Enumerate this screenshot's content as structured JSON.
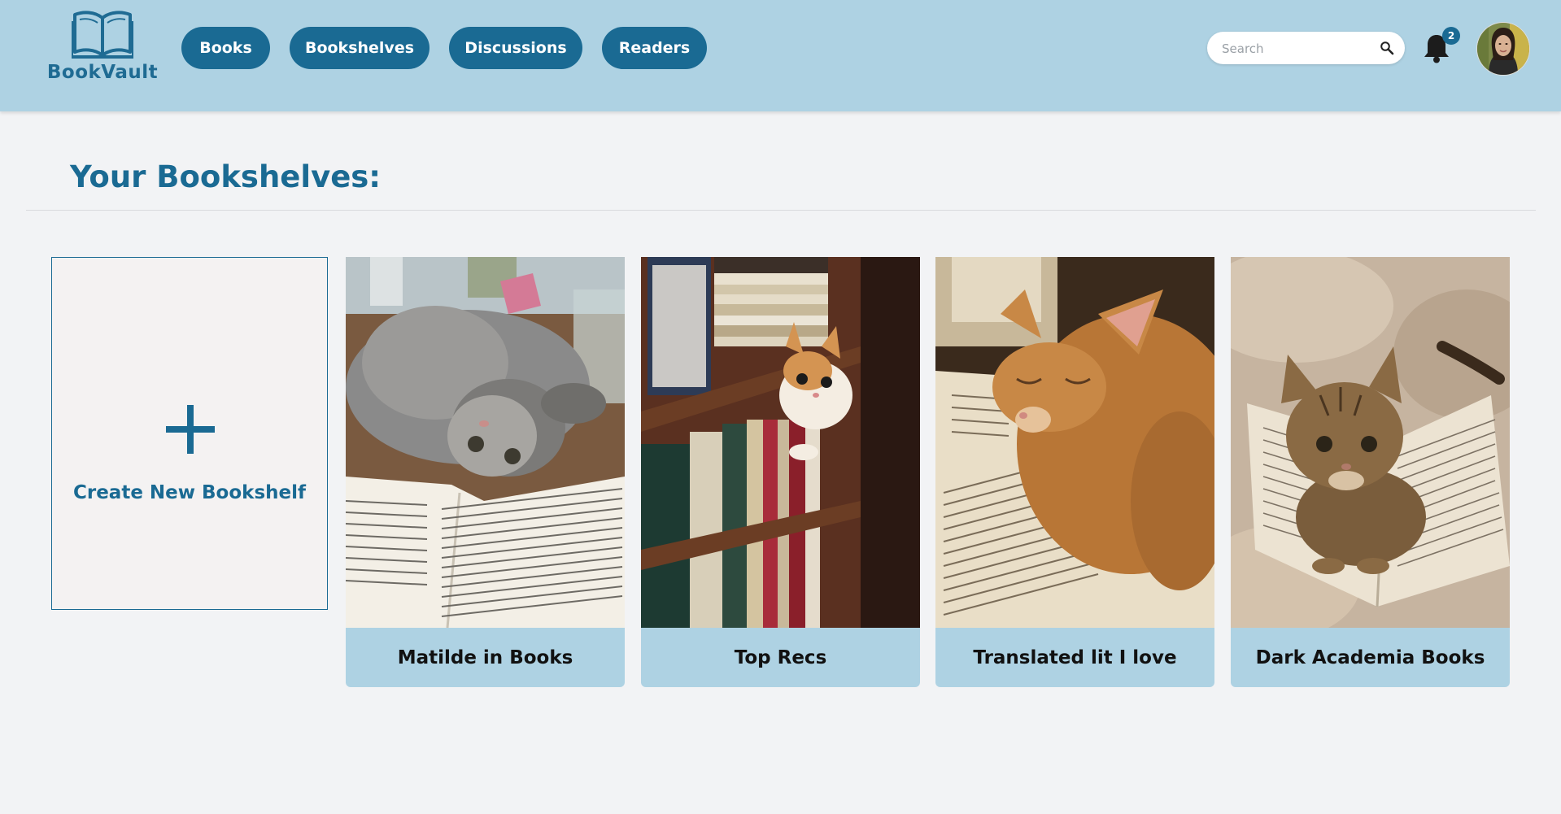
{
  "app": {
    "name": "BookVault"
  },
  "nav": {
    "items": [
      {
        "label": "Books"
      },
      {
        "label": "Bookshelves"
      },
      {
        "label": "Discussions"
      },
      {
        "label": "Readers"
      }
    ]
  },
  "search": {
    "placeholder": "Search",
    "value": ""
  },
  "notifications": {
    "count": "2"
  },
  "icons": {
    "logo": "open-book-icon",
    "search": "magnifier-icon",
    "notifications": "bell-icon",
    "create": "plus-icon"
  },
  "colors": {
    "header_bg": "#aed2e3",
    "accent": "#1a6a93",
    "page_bg": "#f2f3f5",
    "card_label_bg": "#aed2e3"
  },
  "main": {
    "title": "Your Bookshelves:",
    "create_label": "Create New Bookshelf",
    "shelves": [
      {
        "name": "Matilde in Books",
        "photo": "grey fluffy kitten lying on an open book"
      },
      {
        "name": "Top Recs",
        "photo": "orange and white kitten peeking from a bookshelf"
      },
      {
        "name": "Translated lit I love",
        "photo": "orange cat sleeping on an open book"
      },
      {
        "name": "Dark Academia Books",
        "photo": "tabby kitten on an open book on a blanket"
      }
    ]
  }
}
